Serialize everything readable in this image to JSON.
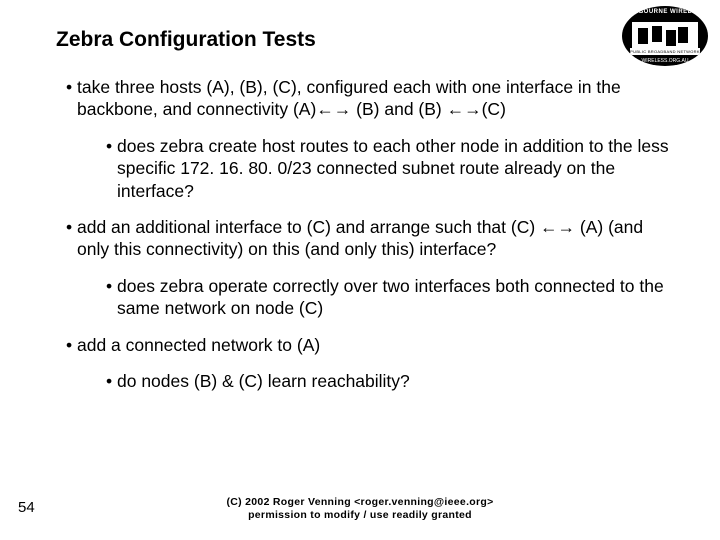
{
  "title": "Zebra Configuration Tests",
  "bullets": {
    "a": "take three hosts (A), (B), (C), configured each with one interface in the backbone, and connectivity (A)←→ (B) and (B) ←→(C)",
    "a1": "does zebra create host routes to each other node in addition to the less specific 172. 16. 80. 0/23 connected subnet route already on the interface?",
    "b": "add an additional interface to (C) and arrange such that (C) ←→ (A) (and only this connectivity) on this (and only this) interface?",
    "b1": "does zebra operate correctly over two interfaces both connected to the same network on node (C)",
    "c": "add a connected network to (A)",
    "c1": "do nodes (B) & (C) learn reachability?"
  },
  "logo": {
    "top": "MELBOURNE WIRELESS",
    "band": "PUBLIC BROADBAND NETWORK",
    "url": "WIRELESS.ORG.AU"
  },
  "page": "54",
  "footer": {
    "line1": "(C) 2002 Roger Venning <roger.venning@ieee.org>",
    "line2": "permission to modify / use readily granted"
  }
}
